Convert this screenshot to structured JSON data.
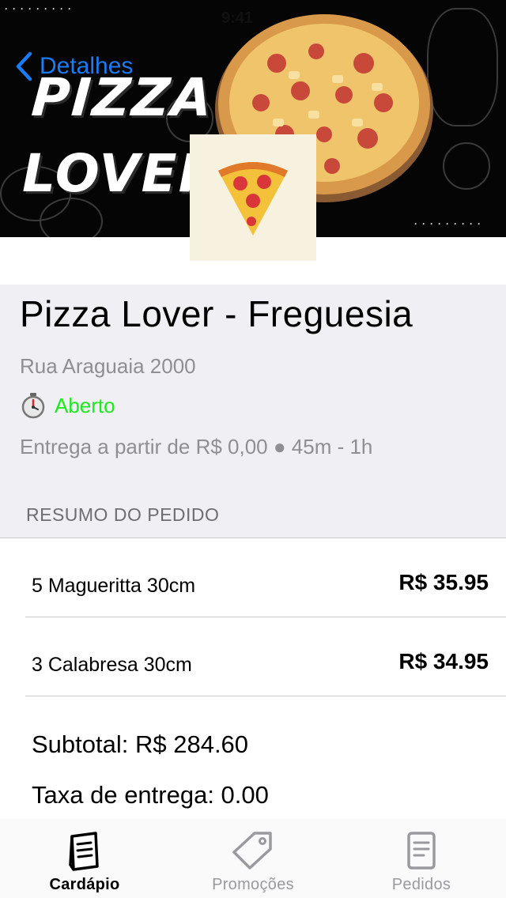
{
  "status_bar": {
    "time": "9:41"
  },
  "nav": {
    "back_label": "Detalhes"
  },
  "hero": {
    "brand_line1": "PIZZA",
    "brand_line2": "LOVER"
  },
  "store": {
    "name": "Pizza Lover - Freguesia",
    "address": "Rua Araguaia 2000",
    "status": "Aberto",
    "delivery_info": "Entrega a partir de R$ 0,00 ● 45m - 1h"
  },
  "order": {
    "section_title": "RESUMO DO PEDIDO",
    "items": [
      {
        "label": "5 Magueritta 30cm",
        "price": "R$ 35.95"
      },
      {
        "label": "3 Calabresa 30cm",
        "price": "R$ 34.95"
      }
    ],
    "subtotal": "Subtotal: R$ 284.60",
    "delivery_fee": "Taxa de entrega: 0.00"
  },
  "tabs": [
    {
      "label": "Cardápio",
      "icon": "menu-book-icon",
      "active": true
    },
    {
      "label": "Promoções",
      "icon": "tag-icon",
      "active": false
    },
    {
      "label": "Pedidos",
      "icon": "receipt-icon",
      "active": false
    }
  ],
  "colors": {
    "accent": "#1a7cf5",
    "open_status": "#1ee81e",
    "muted_text": "#8e8e93",
    "info_background": "#efeff4"
  }
}
